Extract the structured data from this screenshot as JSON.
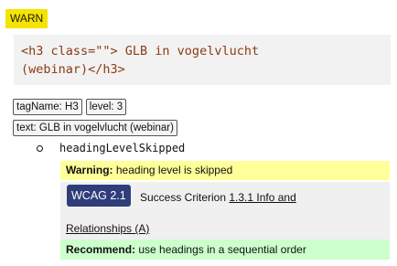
{
  "badge": {
    "label": "WARN",
    "color": "#f5e400"
  },
  "element": {
    "code_line1": "<h3 class=\"\"> GLB in vogelvlucht",
    "code_line2": "(webinar)</h3>"
  },
  "properties": {
    "tag_name": "tagName: H3",
    "level": "level: 3",
    "text": "text: GLB in vogelvlucht (webinar)"
  },
  "rule": {
    "id": "headingLevelSkipped",
    "warning_prefix": "Warning:",
    "warning_text": " heading level is skipped",
    "wcag_badge": "WCAG 2.1",
    "sc_prefix": "Success Criterion ",
    "sc_link_part1": "1.3.1 Info and",
    "sc_link_part2": "Relationships (A)",
    "recommend_prefix": "Recommend:",
    "recommend_text": " use headings in a sequential order"
  },
  "colors": {
    "warning_bg": "#ffff99",
    "recommend_bg": "#ccffcc",
    "wcag_badge_bg": "#2f3e7a",
    "code_color": "#8a3b14"
  }
}
